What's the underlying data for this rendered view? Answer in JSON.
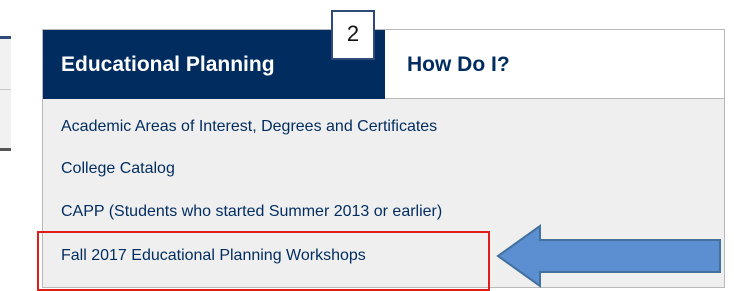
{
  "tabs": {
    "active_label": "Educational Planning",
    "inactive_label": "How Do I?"
  },
  "menu": {
    "items": [
      "Academic Areas of Interest, Degrees and Certificates",
      "College Catalog",
      "CAPP (Students who started Summer 2013 or earlier)",
      "Fall 2017 Educational Planning Workshops"
    ]
  },
  "annotations": {
    "step_number": "2",
    "highlighted_item": "Fall 2017 Educational Planning Workshops",
    "arrow_direction": "left",
    "highlight_color": "#e21b1b",
    "arrow_color": "#5b8fd1"
  },
  "colors": {
    "tab_active_bg": "#002c5f",
    "link_text": "#002c5f",
    "menu_bg": "#efefef"
  }
}
